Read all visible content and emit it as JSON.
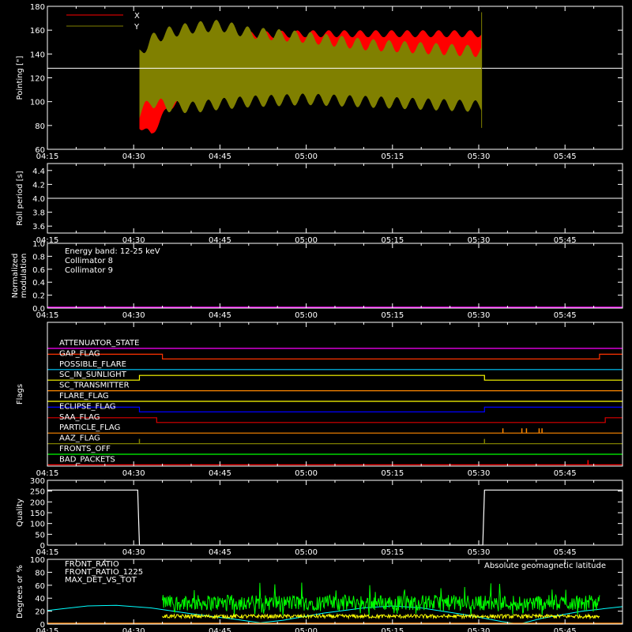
{
  "time_ticks": [
    "04:15",
    "04:30",
    "04:45",
    "05:00",
    "05:15",
    "05:30",
    "05:45"
  ],
  "chart_data": [
    {
      "type": "line",
      "ylabel": "Pointing [\"]",
      "ylim": [
        60,
        180
      ],
      "yticks": [
        60,
        80,
        100,
        120,
        140,
        160,
        180
      ],
      "reference_y": 128,
      "legend": [
        {
          "name": "X",
          "color": "#ff0000"
        },
        {
          "name": "Y",
          "color": "#808000"
        }
      ],
      "series": [
        {
          "name": "X",
          "color": "#ff0000",
          "x": [
            "04:31",
            "04:33",
            "04:36",
            "04:40",
            "04:45",
            "04:50",
            "05:00",
            "05:10",
            "05:20",
            "05:30.5"
          ],
          "upper": [
            130,
            150,
            152,
            154,
            155,
            156,
            157,
            157,
            157,
            157
          ],
          "lower": [
            80,
            72,
            95,
            105,
            112,
            116,
            120,
            124,
            126,
            128
          ]
        },
        {
          "name": "Y",
          "color": "#808000",
          "x": [
            "04:31",
            "04:33",
            "04:36",
            "04:40",
            "04:45",
            "04:50",
            "05:00",
            "05:10",
            "05:20",
            "05:30.5"
          ],
          "upper": [
            140,
            152,
            158,
            162,
            164,
            158,
            154,
            148,
            145,
            142
          ],
          "lower": [
            90,
            100,
            96,
            95,
            98,
            100,
            102,
            100,
            98,
            96
          ]
        }
      ]
    },
    {
      "type": "line",
      "ylabel": "Roll period [s]",
      "ylim": [
        3.5,
        4.5
      ],
      "yticks": [
        "3.6",
        "3.8",
        "4.0",
        "4.2",
        "4.4"
      ],
      "series": [
        {
          "value": 4.0,
          "color": "#ffffff"
        }
      ]
    },
    {
      "type": "line",
      "ylabel": [
        "Normalized",
        "modulation"
      ],
      "ylim": [
        0,
        1
      ],
      "yticks": [
        "0.0",
        "0.2",
        "0.4",
        "0.6",
        "0.8",
        "1.0"
      ],
      "legend": [
        {
          "name": "Energy band: 12-25 keV",
          "color": "#ffffff"
        },
        {
          "name": "Collimator 8",
          "color": "#00ffff"
        },
        {
          "name": "Collimator 9",
          "color": "#ff00ff"
        }
      ],
      "series": [
        {
          "name": "Collimator 9",
          "value": 0.0,
          "color": "#ff00ff"
        }
      ]
    },
    {
      "type": "line",
      "ylabel": "Flags",
      "flags": [
        {
          "name": "ATTENUATOR_STATE",
          "color": "#ff00ff",
          "steps": [
            [
              "04:15",
              0
            ]
          ]
        },
        {
          "name": "GAP_FLAG",
          "color": "#ff3300",
          "steps": [
            [
              "04:15",
              1
            ],
            [
              "04:35",
              0
            ],
            [
              "05:51",
              1
            ]
          ]
        },
        {
          "name": "POSSIBLE_FLARE",
          "color": "#00ccff",
          "steps": [
            [
              "04:15",
              0
            ]
          ]
        },
        {
          "name": "SC_IN_SUNLIGHT",
          "color": "#ffff00",
          "steps": [
            [
              "04:15",
              0
            ],
            [
              "04:31",
              1
            ],
            [
              "05:31",
              0
            ]
          ]
        },
        {
          "name": "SC_TRANSMITTER",
          "color": "#ff8800",
          "steps": [
            [
              "04:15",
              0
            ]
          ]
        },
        {
          "name": "FLARE_FLAG",
          "color": "#ffff00",
          "steps": [
            [
              "04:15",
              0
            ]
          ]
        },
        {
          "name": "ECLIPSE_FLAG",
          "color": "#0000ff",
          "steps": [
            [
              "04:15",
              1
            ],
            [
              "04:31",
              0
            ],
            [
              "05:31",
              1
            ]
          ]
        },
        {
          "name": "SAA_FLAG",
          "color": "#dd0000",
          "steps": [
            [
              "04:15",
              1
            ],
            [
              "04:34",
              0
            ],
            [
              "05:52",
              1
            ]
          ]
        },
        {
          "name": "PARTICLE_FLAG",
          "color": "#ff8800",
          "steps": [
            [
              "04:15",
              0
            ]
          ],
          "spikes": [
            "05:34.2",
            "05:37.5",
            "05:38.3",
            "05:40.5",
            "05:41"
          ]
        },
        {
          "name": "AAZ_FLAG",
          "color": "#808000",
          "steps": [
            [
              "04:15",
              0
            ]
          ],
          "spikes": [
            "04:31",
            "05:31"
          ]
        },
        {
          "name": "FRONTS_OFF",
          "color": "#00ff00",
          "steps": [
            [
              "04:15",
              0
            ]
          ]
        },
        {
          "name": "BAD_PACKETS",
          "color": "#ff0000",
          "steps": [
            [
              "04:15",
              0
            ]
          ],
          "spikes": [
            "05:49"
          ]
        }
      ]
    },
    {
      "type": "line",
      "ylabel": "Quality",
      "ylim": [
        0,
        300
      ],
      "yticks": [
        0,
        50,
        100,
        150,
        200,
        250,
        300
      ],
      "series": [
        {
          "color": "#ffffff",
          "points": [
            [
              "04:15",
              255
            ],
            [
              "04:30.7",
              255
            ],
            [
              "04:31",
              0
            ],
            [
              "05:30.7",
              0
            ],
            [
              "05:31",
              255
            ],
            [
              "05:55",
              255
            ]
          ]
        }
      ]
    },
    {
      "type": "line",
      "ylabel": "Degrees or %",
      "ylim": [
        0,
        100
      ],
      "yticks": [
        0,
        20,
        40,
        60,
        80,
        100
      ],
      "legend": [
        {
          "name": "FRONT_RATIO",
          "color": "#ffff00"
        },
        {
          "name": "FRONT_RATIO_1225",
          "color": "#00ff00"
        },
        {
          "name": "MAX_DET_VS_TOT",
          "color": "#ff8800"
        }
      ],
      "annotation": {
        "text": "Absolute geomagnetic latitude",
        "color": "#00ffff"
      },
      "series": [
        {
          "name": "FRONT_RATIO_1225",
          "color": "#00ff00",
          "x_range": [
            "04:35",
            "05:51"
          ],
          "mean": 33,
          "spread": 12,
          "peak": 65
        },
        {
          "name": "FRONT_RATIO",
          "color": "#ffff00",
          "x_range": [
            "04:35",
            "05:51"
          ],
          "mean": 12,
          "spread": 3
        },
        {
          "name": "MAX_DET_VS_TOT",
          "color": "#ff8800",
          "x_range": [
            "04:15",
            "05:55"
          ],
          "value": 0
        },
        {
          "name": "Absolute geomagnetic latitude",
          "color": "#00ffff",
          "points": [
            [
              "04:15",
              21
            ],
            [
              "04:22",
              28
            ],
            [
              "04:27",
              29
            ],
            [
              "04:33",
              25
            ],
            [
              "04:40",
              16
            ],
            [
              "04:48",
              7
            ],
            [
              "04:52",
              2
            ],
            [
              "04:56",
              6
            ],
            [
              "05:03",
              17
            ],
            [
              "05:10",
              25
            ],
            [
              "05:15",
              28
            ],
            [
              "05:20",
              25
            ],
            [
              "05:28",
              14
            ],
            [
              "05:34",
              4
            ],
            [
              "05:37",
              0
            ],
            [
              "05:41",
              9
            ],
            [
              "05:48",
              20
            ],
            [
              "05:55",
              27
            ]
          ]
        }
      ]
    }
  ]
}
